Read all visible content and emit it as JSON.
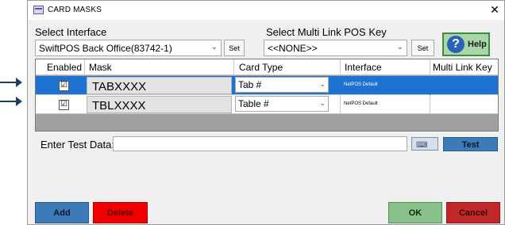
{
  "window": {
    "title": "CARD MASKS",
    "close_glyph": "✕",
    "icon": "app-window-icon"
  },
  "select_interface": {
    "label": "Select Interface",
    "value": "SwiftPOS Back Office(83742-1)",
    "set_label": "Set"
  },
  "select_multilink": {
    "label": "Select Multi Link POS Key",
    "value": "<<NONE>>",
    "set_label": "Set"
  },
  "help": {
    "label": "Help",
    "glyph": "?"
  },
  "grid": {
    "columns": [
      "Enabled",
      "Mask",
      "Card Type",
      "Interface",
      "Multi Link Key"
    ],
    "rows": [
      {
        "enabled": "☑",
        "mask": "TABXXXX",
        "card_type": "Tab #",
        "interface": "NetPOS Default",
        "multi_link_key": "",
        "selected": true
      },
      {
        "enabled": "☑",
        "mask": "TBLXXXX",
        "card_type": "Table #",
        "interface": "NetPOS Default",
        "multi_link_key": "",
        "selected": false
      }
    ]
  },
  "test": {
    "label": "Enter Test Data:",
    "value": "",
    "button_label": "Test"
  },
  "footer": {
    "add_label": "Add",
    "delete_label": "Delete",
    "ok_label": "OK",
    "cancel_label": "Cancel"
  },
  "colors": {
    "selected_row": "#1e73d2",
    "add_button": "#3c7ab8",
    "delete_button": "#f00000",
    "ok_button": "#88c08a",
    "cancel_button": "#c0282a"
  }
}
